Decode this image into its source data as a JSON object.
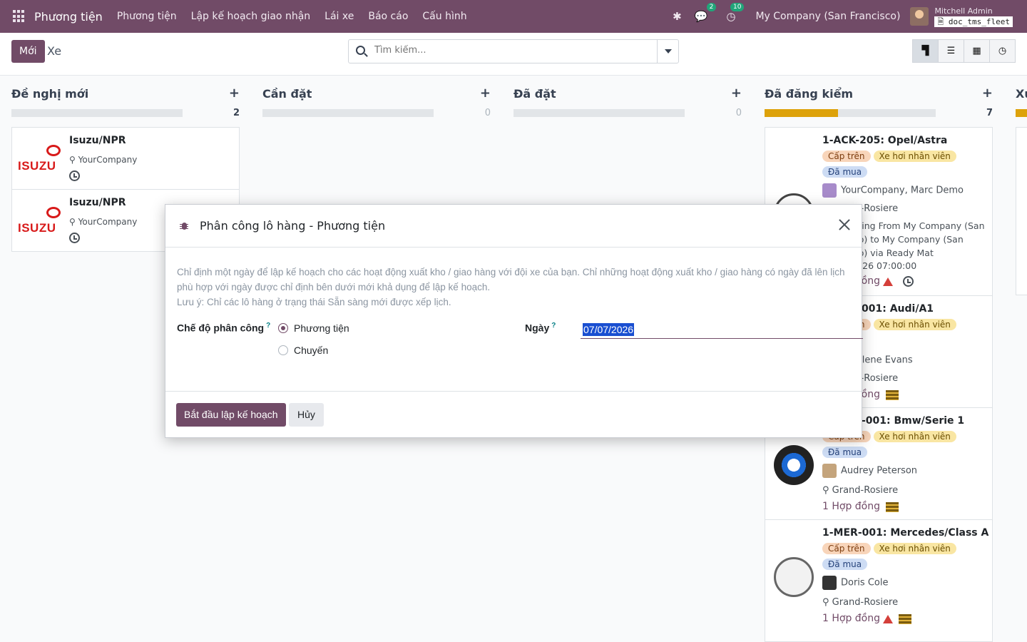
{
  "navbar": {
    "brand": "Phương tiện",
    "menu": [
      "Phương tiện",
      "Lập kế hoạch giao nhận",
      "Lái xe",
      "Báo cáo",
      "Cấu hình"
    ],
    "messages_count": "2",
    "activities_count": "10",
    "company": "My Company (San Francisco)",
    "user_name": "Mitchell Admin",
    "database": "doc_tms_fleet"
  },
  "control": {
    "new_label": "Mới",
    "page_name": "Xe",
    "search_placeholder": "Tìm kiếm..."
  },
  "columns": [
    {
      "title": "Đề nghị mới",
      "count": "2",
      "progress": 1.0,
      "progress_color": "#e2e5e8"
    },
    {
      "title": "Cần đặt",
      "count": "0",
      "progress": 0.0
    },
    {
      "title": "Đã đặt",
      "count": "0",
      "progress": 0.0
    },
    {
      "title": "Đã đăng kiểm",
      "count": "7",
      "progress": 0.43,
      "progress_color": "#dda20a"
    },
    {
      "title": "Xu",
      "count": "",
      "progress": 0.5
    }
  ],
  "cards_new": [
    {
      "title": "Isuzu/NPR",
      "location": "YourCompany"
    },
    {
      "title": "Isuzu/NPR",
      "location": "YourCompany"
    }
  ],
  "cards_registered": [
    {
      "title": "1-ACK-205: Opel/Astra",
      "tags": [
        "Cấp trên",
        "Xe hơi nhân viên"
      ],
      "state_tag": "Đã mua",
      "driver": "YourCompany, Marc Demo",
      "location": "Grand-Rosiere",
      "trip": "[02] Driving From My Company (San Francisco) to My Company (San Francisco) via Ready Mat",
      "date": "07/07/2026 07:00:00",
      "contracts": "1 Hợp đồng"
    },
    {
      "title": "1-AUD-001: Audi/A1",
      "tags": [
        "Cấp trên",
        "Xe hơi nhân viên"
      ],
      "driver": "Sharlene Evans",
      "location": "Grand-Rosiere",
      "contracts": "1 Hợp đồng"
    },
    {
      "title": "1-BMW-001: Bmw/Serie 1",
      "tags": [
        "Cấp trên",
        "Xe hơi nhân viên"
      ],
      "state_tag": "Đã mua",
      "driver": "Audrey Peterson",
      "location": "Grand-Rosiere",
      "contracts": "1 Hợp đồng"
    },
    {
      "title": "1-MER-001: Mercedes/Class A",
      "tags": [
        "Cấp trên",
        "Xe hơi nhân viên"
      ],
      "state_tag": "Đã mua",
      "driver": "Doris Cole",
      "location": "Grand-Rosiere",
      "contracts": "1 Hợp đồng"
    }
  ],
  "modal": {
    "title": "Phân công lô hàng - Phương tiện",
    "description_1": "Chỉ định một ngày để lập kế hoạch cho các hoạt động xuất kho / giao hàng với đội xe của bạn. Chỉ những hoạt động xuất kho / giao hàng có ngày đã lên lịch phù hợp với ngày được chỉ định bên dưới mới khả dụng để lập kế hoạch.",
    "description_2": "Lưu ý: Chỉ các lô hàng ở trạng thái Sẵn sàng mới được xếp lịch.",
    "mode_label": "Chế độ phân công",
    "mode_options": [
      "Phương tiện",
      "Chuyến"
    ],
    "mode_selected": "Phương tiện",
    "date_label": "Ngày",
    "date_value": "07/07/2026",
    "help_mark": "?",
    "primary_button": "Bắt đầu lập kế hoạch",
    "cancel_button": "Hủy"
  }
}
